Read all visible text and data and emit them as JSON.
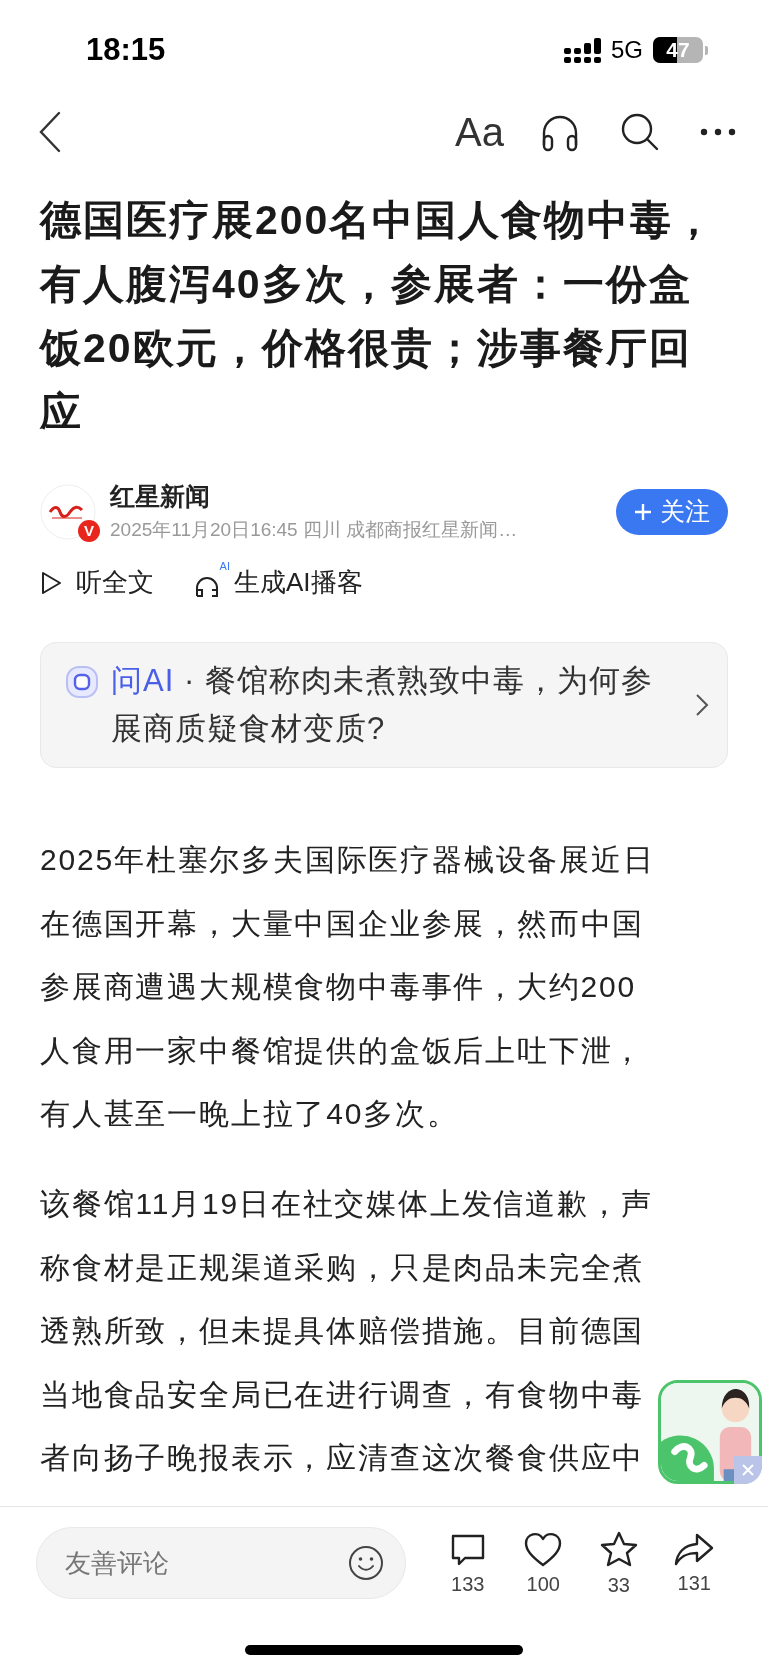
{
  "status_bar": {
    "time": "18:15",
    "network": "5G",
    "battery": "47"
  },
  "nav": {
    "font_button": "Aa"
  },
  "article": {
    "title": "德国医疗展200名中国人食物中毒，有人腹泻40多次，参展者：一份盒饭20欧元，价格很贵；涉事餐厅回应",
    "source": {
      "name": "红星新闻",
      "badge": "V",
      "meta": "2025年11月20日16:45 四川  成都商报红星新闻…",
      "follow_button": "关注"
    },
    "actions": [
      {
        "kind": "listen",
        "label": "听全文"
      },
      {
        "kind": "podcast",
        "label": "生成AI播客",
        "icon_badge": "AI"
      }
    ],
    "ai_card": {
      "label": "问AI",
      "separator": "·",
      "question": "餐馆称肉未煮熟致中毒，为何参展商质疑食材变质?"
    },
    "paragraphs": [
      "2025年杜塞尔多夫国际医疗器械设备展近日在德国开幕，大量中国企业参展，然而中国参展商遭遇大规模食物中毒事件，大约200人食用一家中餐馆提供的盒饭后上吐下泄，有人甚至一晚上拉了40多次。",
      "该餐馆11月19日在社交媒体上发信道歉，声称食材是正规渠道采购，只是肉品未完全煮透熟所致，但未提具体赔偿措施。目前德国当地食品安全局已在进行调查，有食物中毒者向扬子晚报表示，应清查这次餐食供应中"
    ]
  },
  "bottom_bar": {
    "comment_placeholder": "友善评论",
    "stats": [
      {
        "kind": "comment",
        "count": "133"
      },
      {
        "kind": "like",
        "count": "100"
      },
      {
        "kind": "favorite",
        "count": "33"
      },
      {
        "kind": "share",
        "count": "131"
      }
    ]
  }
}
